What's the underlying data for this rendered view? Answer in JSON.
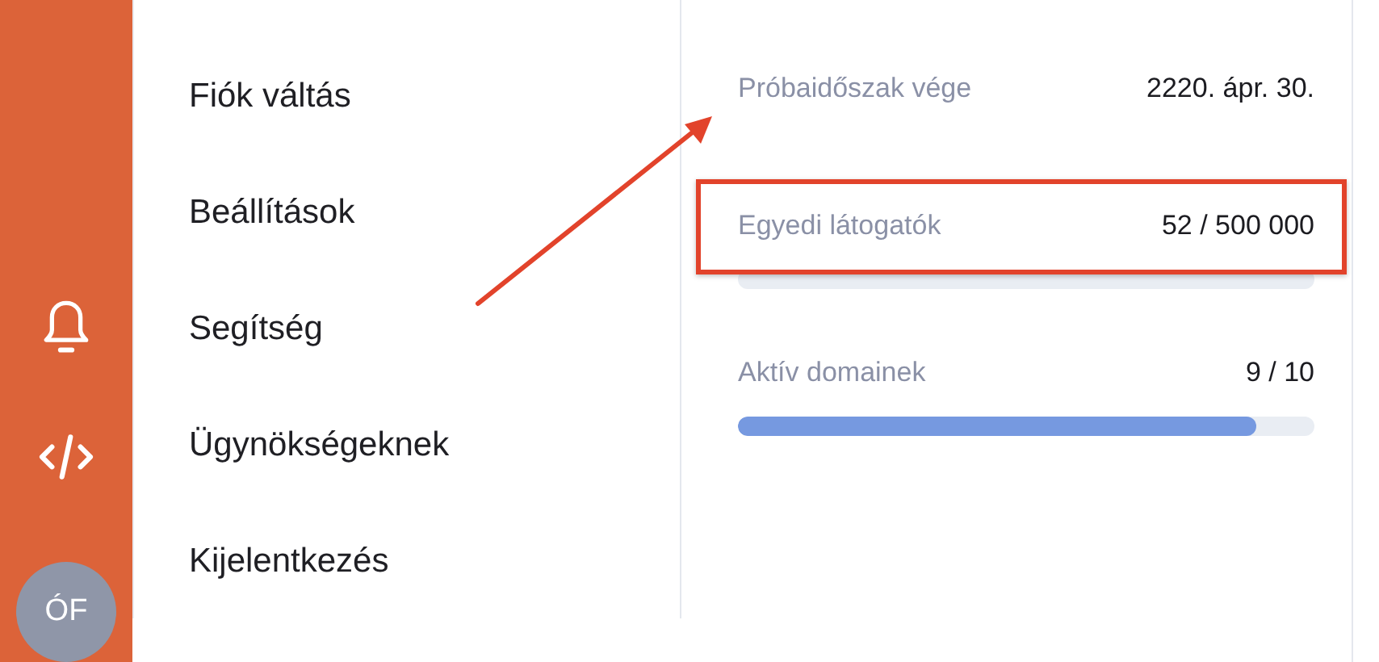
{
  "sidebar": {
    "avatar": "ÓF"
  },
  "menu": {
    "items": [
      "Fiók váltás",
      "Beállítások",
      "Segítség",
      "Ügynökségeknek",
      "Kijelentkezés"
    ]
  },
  "stats": [
    {
      "kind": "text",
      "label": "Próbaidőszak vége",
      "value": "2220. ápr. 30.",
      "highlighted": false
    },
    {
      "kind": "meter",
      "label": "Egyedi látogatók",
      "value": "52 / 500 000",
      "level": 0.0001,
      "highlighted": true
    },
    {
      "kind": "meter",
      "label": "Aktív domainek",
      "value": "9 / 10",
      "level": 0.9,
      "highlighted": false
    }
  ]
}
